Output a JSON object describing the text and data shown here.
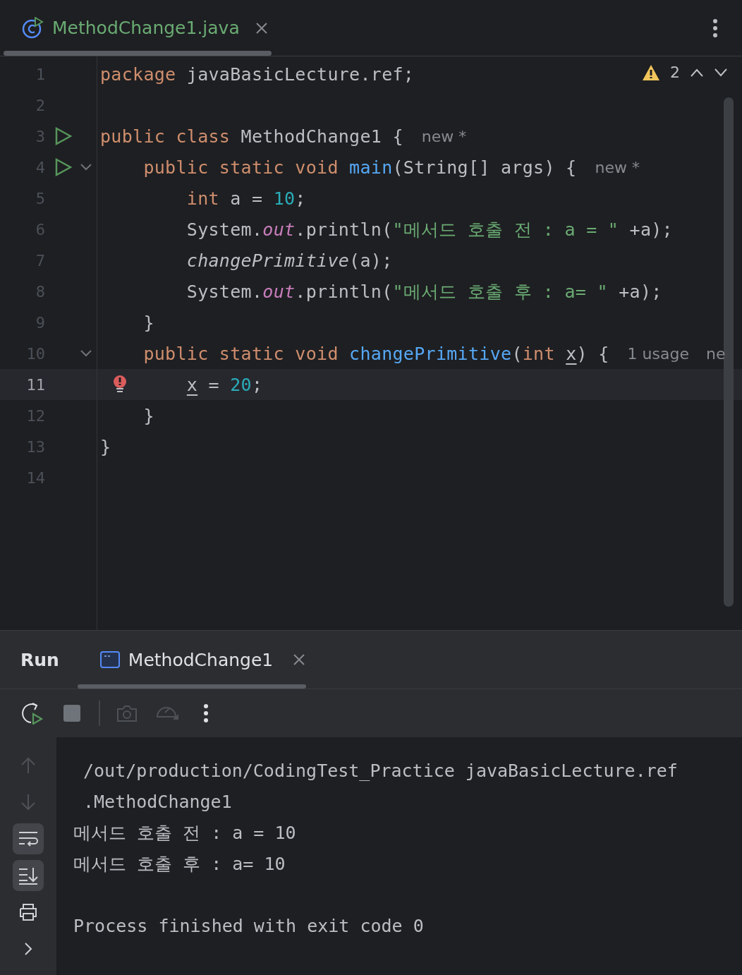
{
  "editor_tab": {
    "label": "MethodChange1.java",
    "selected": true
  },
  "inspections": {
    "count": "2"
  },
  "lines": [
    {
      "number": "1",
      "run_icon": false,
      "fold_icon": false,
      "error_icon": false,
      "current": false,
      "code": [
        {
          "kind": "kw",
          "text": "package"
        },
        {
          "kind": "txt",
          "text": " javaBasicLecture.ref;"
        }
      ]
    },
    {
      "number": "2",
      "run_icon": false,
      "fold_icon": false,
      "error_icon": false,
      "current": false
    },
    {
      "number": "3",
      "run_icon": true,
      "fold_icon": false,
      "error_icon": false,
      "current": false,
      "code": [
        {
          "kind": "kw",
          "text": "public class"
        },
        {
          "kind": "txt",
          "text": " MethodChange1 {"
        }
      ],
      "hints": [
        "new *"
      ]
    },
    {
      "number": "4",
      "run_icon": true,
      "fold_icon": true,
      "error_icon": false,
      "current": false,
      "code": [
        {
          "kind": "kw",
          "text": "    public static void "
        },
        {
          "kind": "fn",
          "text": "main"
        },
        {
          "kind": "txt",
          "text": "(String[] args) {"
        }
      ],
      "hints": [
        "new *"
      ]
    },
    {
      "number": "5",
      "run_icon": false,
      "fold_icon": false,
      "error_icon": false,
      "current": false,
      "code": [
        {
          "kind": "kw",
          "text": "        int"
        },
        {
          "kind": "txt",
          "text": " a = "
        },
        {
          "kind": "num",
          "text": "10"
        },
        {
          "kind": "txt",
          "text": ";"
        }
      ]
    },
    {
      "number": "6",
      "run_icon": false,
      "fold_icon": false,
      "error_icon": false,
      "current": false,
      "code": [
        {
          "kind": "txt",
          "text": "        System."
        },
        {
          "kind": "field",
          "text": "out"
        },
        {
          "kind": "txt",
          "text": ".println("
        },
        {
          "kind": "str",
          "text": "\"메서드 호출 전 : a = \""
        },
        {
          "kind": "txt",
          "text": " +a);"
        }
      ]
    },
    {
      "number": "7",
      "run_icon": false,
      "fold_icon": false,
      "error_icon": false,
      "current": false,
      "code": [
        {
          "kind": "call",
          "text": "        changePrimitive"
        },
        {
          "kind": "txt",
          "text": "(a);"
        }
      ]
    },
    {
      "number": "8",
      "run_icon": false,
      "fold_icon": false,
      "error_icon": false,
      "current": false,
      "code": [
        {
          "kind": "txt",
          "text": "        System."
        },
        {
          "kind": "field",
          "text": "out"
        },
        {
          "kind": "txt",
          "text": ".println("
        },
        {
          "kind": "str",
          "text": "\"메서드 호출 후 : a= \""
        },
        {
          "kind": "txt",
          "text": " +a);"
        }
      ]
    },
    {
      "number": "9",
      "run_icon": false,
      "fold_icon": false,
      "error_icon": false,
      "current": false,
      "code": [
        {
          "kind": "txt",
          "text": "    }"
        }
      ]
    },
    {
      "number": "10",
      "run_icon": false,
      "fold_icon": true,
      "error_icon": false,
      "current": false,
      "code": [
        {
          "kind": "kw",
          "text": "    public static void "
        },
        {
          "kind": "fn",
          "text": "changePrimitive"
        },
        {
          "kind": "txt",
          "text": "("
        },
        {
          "kind": "kw",
          "text": "int "
        },
        {
          "kind": "param",
          "text": "x"
        },
        {
          "kind": "txt",
          "text": ") {"
        }
      ],
      "hints": [
        "1 usage",
        "ne"
      ]
    },
    {
      "number": "11",
      "run_icon": false,
      "fold_icon": false,
      "error_icon": true,
      "current": true,
      "code": [
        {
          "kind": "param",
          "text": "        x"
        },
        {
          "kind": "txt",
          "text": " = "
        },
        {
          "kind": "num",
          "text": "20"
        },
        {
          "kind": "txt",
          "text": ";"
        }
      ]
    },
    {
      "number": "12",
      "run_icon": false,
      "fold_icon": false,
      "error_icon": false,
      "current": false,
      "code": [
        {
          "kind": "txt",
          "text": "    }"
        }
      ]
    },
    {
      "number": "13",
      "run_icon": false,
      "fold_icon": false,
      "error_icon": false,
      "current": false,
      "code": [
        {
          "kind": "txt",
          "text": "}"
        }
      ]
    },
    {
      "number": "14",
      "run_icon": false,
      "fold_icon": false,
      "error_icon": false,
      "current": false
    }
  ],
  "run_panel": {
    "title": "Run",
    "tab": {
      "label": "MethodChange1",
      "selected": true
    }
  },
  "toolbar": [
    {
      "disabled": false
    },
    {
      "disabled": false
    },
    {
      "disabled": true
    },
    {
      "disabled": true
    },
    {
      "disabled": false
    }
  ],
  "side_toolbar": [
    {
      "selected": false,
      "disabled": true
    },
    {
      "selected": false,
      "disabled": true
    },
    {
      "selected": true,
      "disabled": false
    },
    {
      "selected": true,
      "disabled": false
    },
    {
      "selected": false,
      "disabled": false
    },
    {
      "selected": false,
      "disabled": false
    }
  ],
  "console": [
    {
      "kind": "wrapped",
      "text": "/out/production/CodingTest_Practice javaBasicLecture.ref"
    },
    {
      "kind": "wrapped",
      "text": ".MethodChange1"
    },
    {
      "kind": "output",
      "text": "메서드 호출 전 : a = 10"
    },
    {
      "kind": "output",
      "text": "메서드 호출 후 : a= 10"
    },
    {
      "kind": "summary",
      "text": "Process finished with exit code 0"
    }
  ]
}
